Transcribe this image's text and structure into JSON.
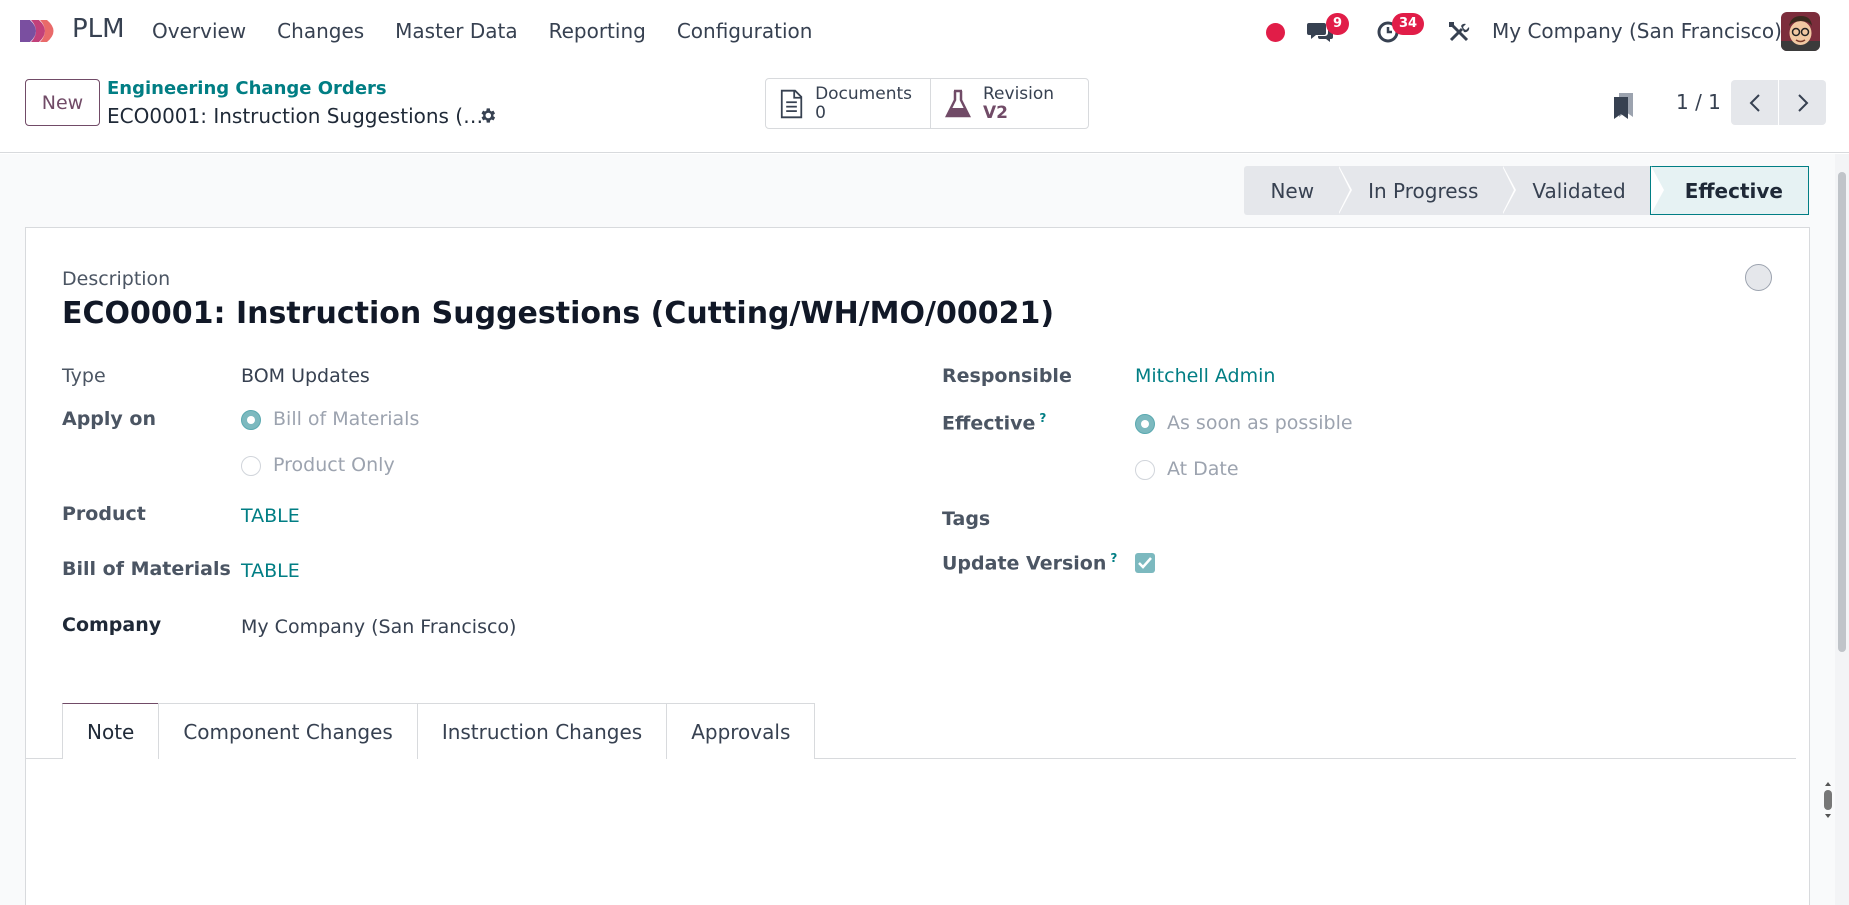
{
  "app": {
    "name": "PLM"
  },
  "menu": [
    "Overview",
    "Changes",
    "Master Data",
    "Reporting",
    "Configuration"
  ],
  "systray": {
    "messages_badge": "9",
    "activities_badge": "34",
    "company": "My Company (San Francisco)"
  },
  "control": {
    "new_label": "New",
    "breadcrumb": "Engineering Change Orders",
    "record_title": "ECO0001: Instruction Suggestions (…",
    "smart_buttons": [
      {
        "label": "Documents",
        "value": "0",
        "icon": "document-icon"
      },
      {
        "label": "Revision",
        "value": "V2",
        "icon": "flask-icon"
      }
    ],
    "pager": "1 / 1"
  },
  "statusbar": {
    "stages": [
      "New",
      "In Progress",
      "Validated",
      "Effective"
    ],
    "active": "Effective"
  },
  "form": {
    "description_label": "Description",
    "title": "ECO0001: Instruction Suggestions (Cutting/WH/MO/00021)",
    "type_label": "Type",
    "type_value": "BOM Updates",
    "apply_on_label": "Apply on",
    "apply_on_options": [
      "Bill of Materials",
      "Product Only"
    ],
    "product_label": "Product",
    "product_value": "TABLE",
    "bom_label": "Bill of Materials",
    "bom_value": "TABLE",
    "company_label": "Company",
    "company_value": "My Company (San Francisco)",
    "responsible_label": "Responsible",
    "responsible_value": "Mitchell Admin",
    "effective_label": "Effective",
    "effective_help": "?",
    "effective_options": [
      "As soon as possible",
      "At Date"
    ],
    "tags_label": "Tags",
    "update_version_label": "Update Version",
    "update_version_help": "?"
  },
  "tabs": [
    "Note",
    "Component Changes",
    "Instruction Changes",
    "Approvals"
  ],
  "colors": {
    "brand": "#714b67",
    "link": "#017e84",
    "badge": "#e11d48"
  }
}
